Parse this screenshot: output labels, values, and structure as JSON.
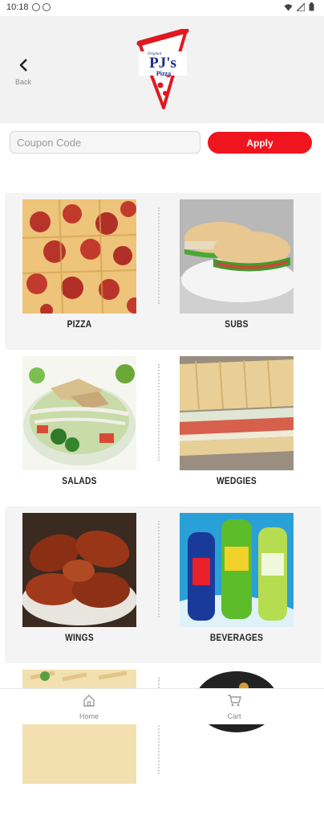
{
  "status_bar": {
    "time": "10:18"
  },
  "header": {
    "back_label": "Back",
    "logo_alt": "PJ's Pizza"
  },
  "coupon": {
    "placeholder": "Coupon Code",
    "apply_label": "Apply"
  },
  "categories": [
    {
      "label": "PIZZA"
    },
    {
      "label": "SUBS"
    },
    {
      "label": "SALADS"
    },
    {
      "label": "WEDGIES"
    },
    {
      "label": "WINGS"
    },
    {
      "label": "BEVERAGES"
    }
  ],
  "bottom_nav": {
    "home_label": "Home",
    "cart_label": "Cart"
  },
  "colors": {
    "accent": "#f0141e",
    "brand_blue": "#1b2a8a"
  }
}
